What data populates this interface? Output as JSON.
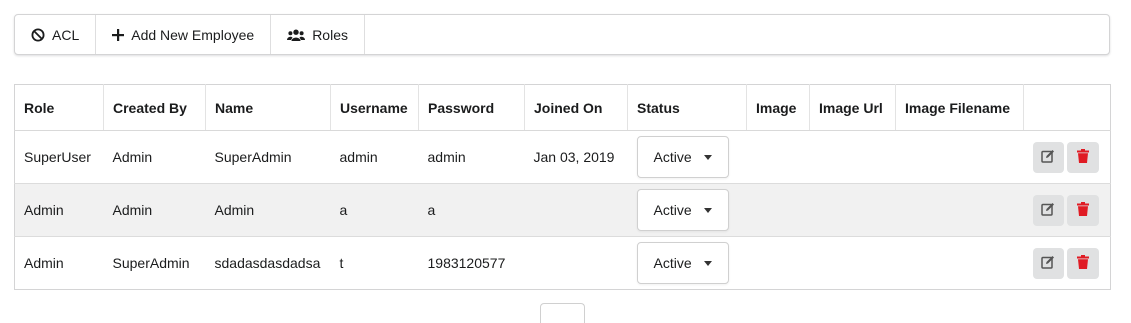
{
  "toolbar": {
    "items": [
      {
        "label": "ACL",
        "icon": "ban-icon"
      },
      {
        "label": "Add New Employee",
        "icon": "plus-icon"
      },
      {
        "label": "Roles",
        "icon": "users-icon"
      }
    ]
  },
  "table": {
    "headers": [
      "Role",
      "Created By",
      "Name",
      "Username",
      "Password",
      "Joined On",
      "Status",
      "Image",
      "Image Url",
      "Image Filename",
      ""
    ],
    "rows": [
      {
        "role": "SuperUser",
        "created_by": "Admin",
        "name": "SuperAdmin",
        "username": "admin",
        "password": "admin",
        "joined_on": "Jan 03, 2019",
        "status": "Active",
        "image": "",
        "image_url": "",
        "image_filename": ""
      },
      {
        "role": "Admin",
        "created_by": "Admin",
        "name": "Admin",
        "username": "a",
        "password": "a",
        "joined_on": "",
        "status": "Active",
        "image": "",
        "image_url": "",
        "image_filename": ""
      },
      {
        "role": "Admin",
        "created_by": "SuperAdmin",
        "name": "sdadasdasdadsa",
        "username": "t",
        "password": "1983120577",
        "joined_on": "",
        "status": "Active",
        "image": "",
        "image_url": "",
        "image_filename": ""
      }
    ]
  },
  "colors": {
    "delete_icon": "#e01b24",
    "edit_icon": "#555555",
    "action_bg": "#e0e1e2",
    "row_alt_bg": "#f1f1f1"
  }
}
